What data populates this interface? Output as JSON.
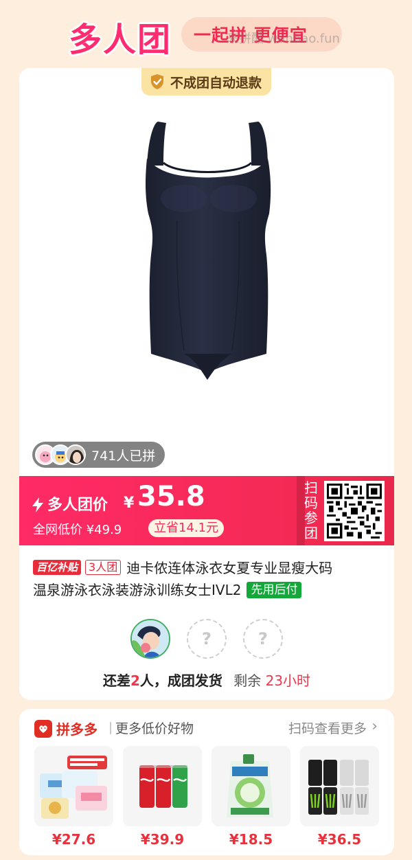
{
  "header": {
    "logo": "多人团",
    "slogan": "一起拼 更便宜",
    "watermark": "来拼酷 wanbao.fun"
  },
  "product": {
    "refund_badge": "不成团自动退款",
    "joined": "741人已拼",
    "group_label": "多人团价",
    "currency": "¥",
    "price": "35.8",
    "net_low_price": "全网低价 ¥49.9",
    "save": "立省14.1元",
    "scan_group": [
      "扫",
      "码",
      "参",
      "团"
    ],
    "tag_subsidy": "百亿补贴",
    "tag_team": "3人团",
    "title_line1": "迪卡侬连体泳衣女夏专业显瘦大码",
    "title_line2": "温泉游泳衣泳装游泳训练女士IVL2",
    "tag_pay_later": "先用后付",
    "swimsuit_color": "#23283a"
  },
  "group": {
    "status_prefix": "还差",
    "missing": "2",
    "status_suffix": "人，成团发货",
    "remain_label": "剩余",
    "remain_time": "23小时",
    "empty_slot": "?"
  },
  "more": {
    "brand": "拼多多",
    "title": "更多低价好物",
    "scan_more": "扫码查看更多",
    "chevron": "›",
    "items": [
      {
        "price": "¥27.6",
        "icon": "tissue-pack-icon"
      },
      {
        "price": "¥39.9",
        "icon": "soda-cans-icon"
      },
      {
        "price": "¥18.5",
        "icon": "detergent-bag-icon"
      },
      {
        "price": "¥36.5",
        "icon": "energy-drink-icon"
      }
    ]
  },
  "colors": {
    "accent": "#ff2a66",
    "brand_red": "#e02e24",
    "page_bg": "#fdeede",
    "green_tag": "#14a83a"
  }
}
